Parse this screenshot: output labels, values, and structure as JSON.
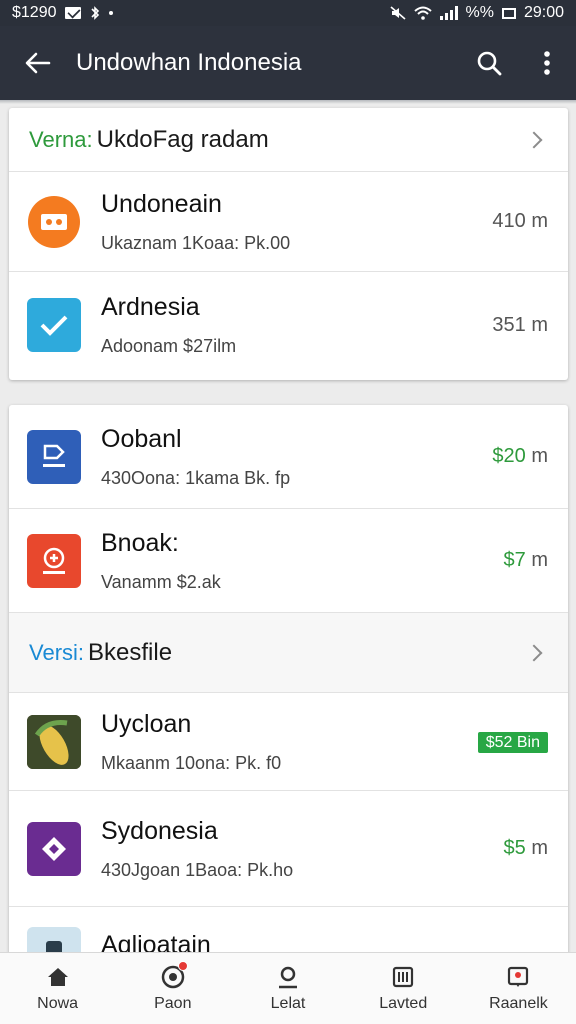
{
  "status_bar": {
    "time_left": "$1290",
    "time_right": "29:00",
    "battery": "%%"
  },
  "app_bar": {
    "title": "Undowhan Indonesia"
  },
  "section1": {
    "tag": "Verna:",
    "title": "UkdoFag radam",
    "items": [
      {
        "name": "Undoneain",
        "sub": "Ukaznam 1Koaa: Pk.00",
        "size": "410 m",
        "icon": "orange-chat-icon",
        "icon_color": "#f47b20"
      },
      {
        "name": "Ardnesia",
        "sub": "Adoonam $27ilm",
        "size": "351 m",
        "icon": "check-icon",
        "icon_color": "#2eaadc"
      }
    ]
  },
  "section2": {
    "items": [
      {
        "name": "Oobanl",
        "sub": "430Oona: 1kama Bk. fp",
        "price": "$20",
        "unit": "m",
        "icon": "blue-app-icon",
        "icon_color": "#2f5fb8"
      },
      {
        "name": "Bnoak:",
        "sub": "Vanamm $2.ak",
        "price": "$7",
        "unit": "m",
        "icon": "red-app-icon",
        "icon_color": "#e8482d"
      }
    ]
  },
  "section3": {
    "tag": "Versi:",
    "title": "Bkesfile",
    "items": [
      {
        "name": "Uycloan",
        "sub": "Mkaanm 10ona: Pk. f0",
        "badge": "$52 Bin",
        "icon": "corn-icon",
        "icon_color": "#c9a13a"
      },
      {
        "name": "Sydonesia",
        "sub": "430Jgoan 1Baoa: Pk.ho",
        "price": "$5",
        "unit": "m",
        "icon": "purple-diamond-icon",
        "icon_color": "#6a2c91"
      },
      {
        "name": "Aqlioatain",
        "sub": "",
        "icon": "phone-icon",
        "icon_color": "#3a7ca5"
      }
    ]
  },
  "bottom_nav": [
    {
      "label": "Nowa",
      "icon": "home-icon"
    },
    {
      "label": "Paon",
      "icon": "notification-icon"
    },
    {
      "label": "Lelat",
      "icon": "person-icon"
    },
    {
      "label": "Lavted",
      "icon": "library-icon"
    },
    {
      "label": "Raanelk",
      "icon": "account-icon"
    }
  ],
  "colors": {
    "app_bar": "#2d323d",
    "accent_green": "#2e9a3c",
    "tag_blue": "#1a8ad4",
    "tag_green": "#2e9a3c"
  }
}
